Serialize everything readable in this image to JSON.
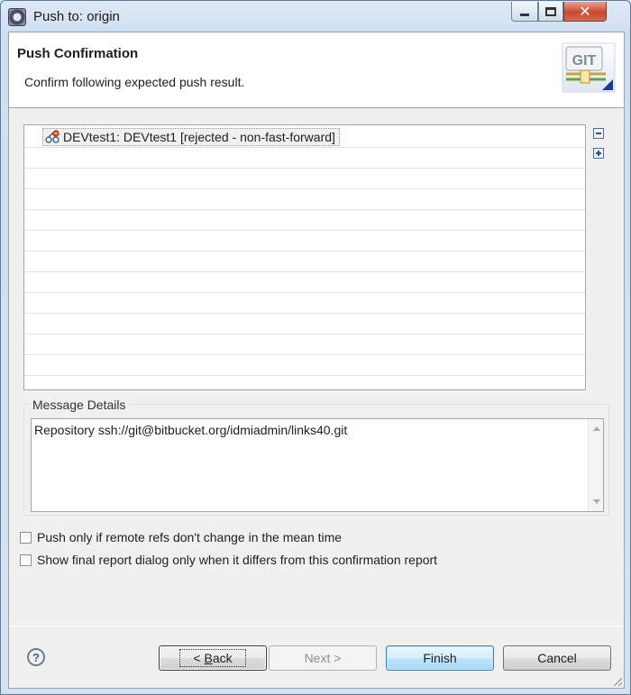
{
  "window": {
    "title": "Push to: origin"
  },
  "banner": {
    "title": "Push Confirmation",
    "description": "Confirm following expected push result.",
    "logo_text": "GIT"
  },
  "tree": {
    "items": [
      {
        "label": "DEVtest1: DEVtest1 [rejected - non-fast-forward]",
        "icon": "push-ref-icon"
      }
    ],
    "tools": [
      "collapse-all-icon",
      "expand-all-icon"
    ]
  },
  "message_details": {
    "label": "Message Details",
    "text": "Repository ssh://git@bitbucket.org/idmiadmin/links40.git"
  },
  "options": {
    "push_only_if_unchanged": {
      "label": "Push only if remote refs don't change in the mean time",
      "checked": false
    },
    "show_final_report": {
      "label": "Show final report dialog only when it differs from this confirmation report",
      "checked": false
    }
  },
  "footer": {
    "help_glyph": "?",
    "back_label_prefix": "< ",
    "back_label_mnemonic": "B",
    "back_label_rest": "ack",
    "next_label": "Next >",
    "finish_label": "Finish",
    "cancel_label": "Cancel"
  },
  "colors": {
    "finish_accent": "#bee6fd",
    "close_button": "#c8482f",
    "frame": "#d6e3f2"
  }
}
